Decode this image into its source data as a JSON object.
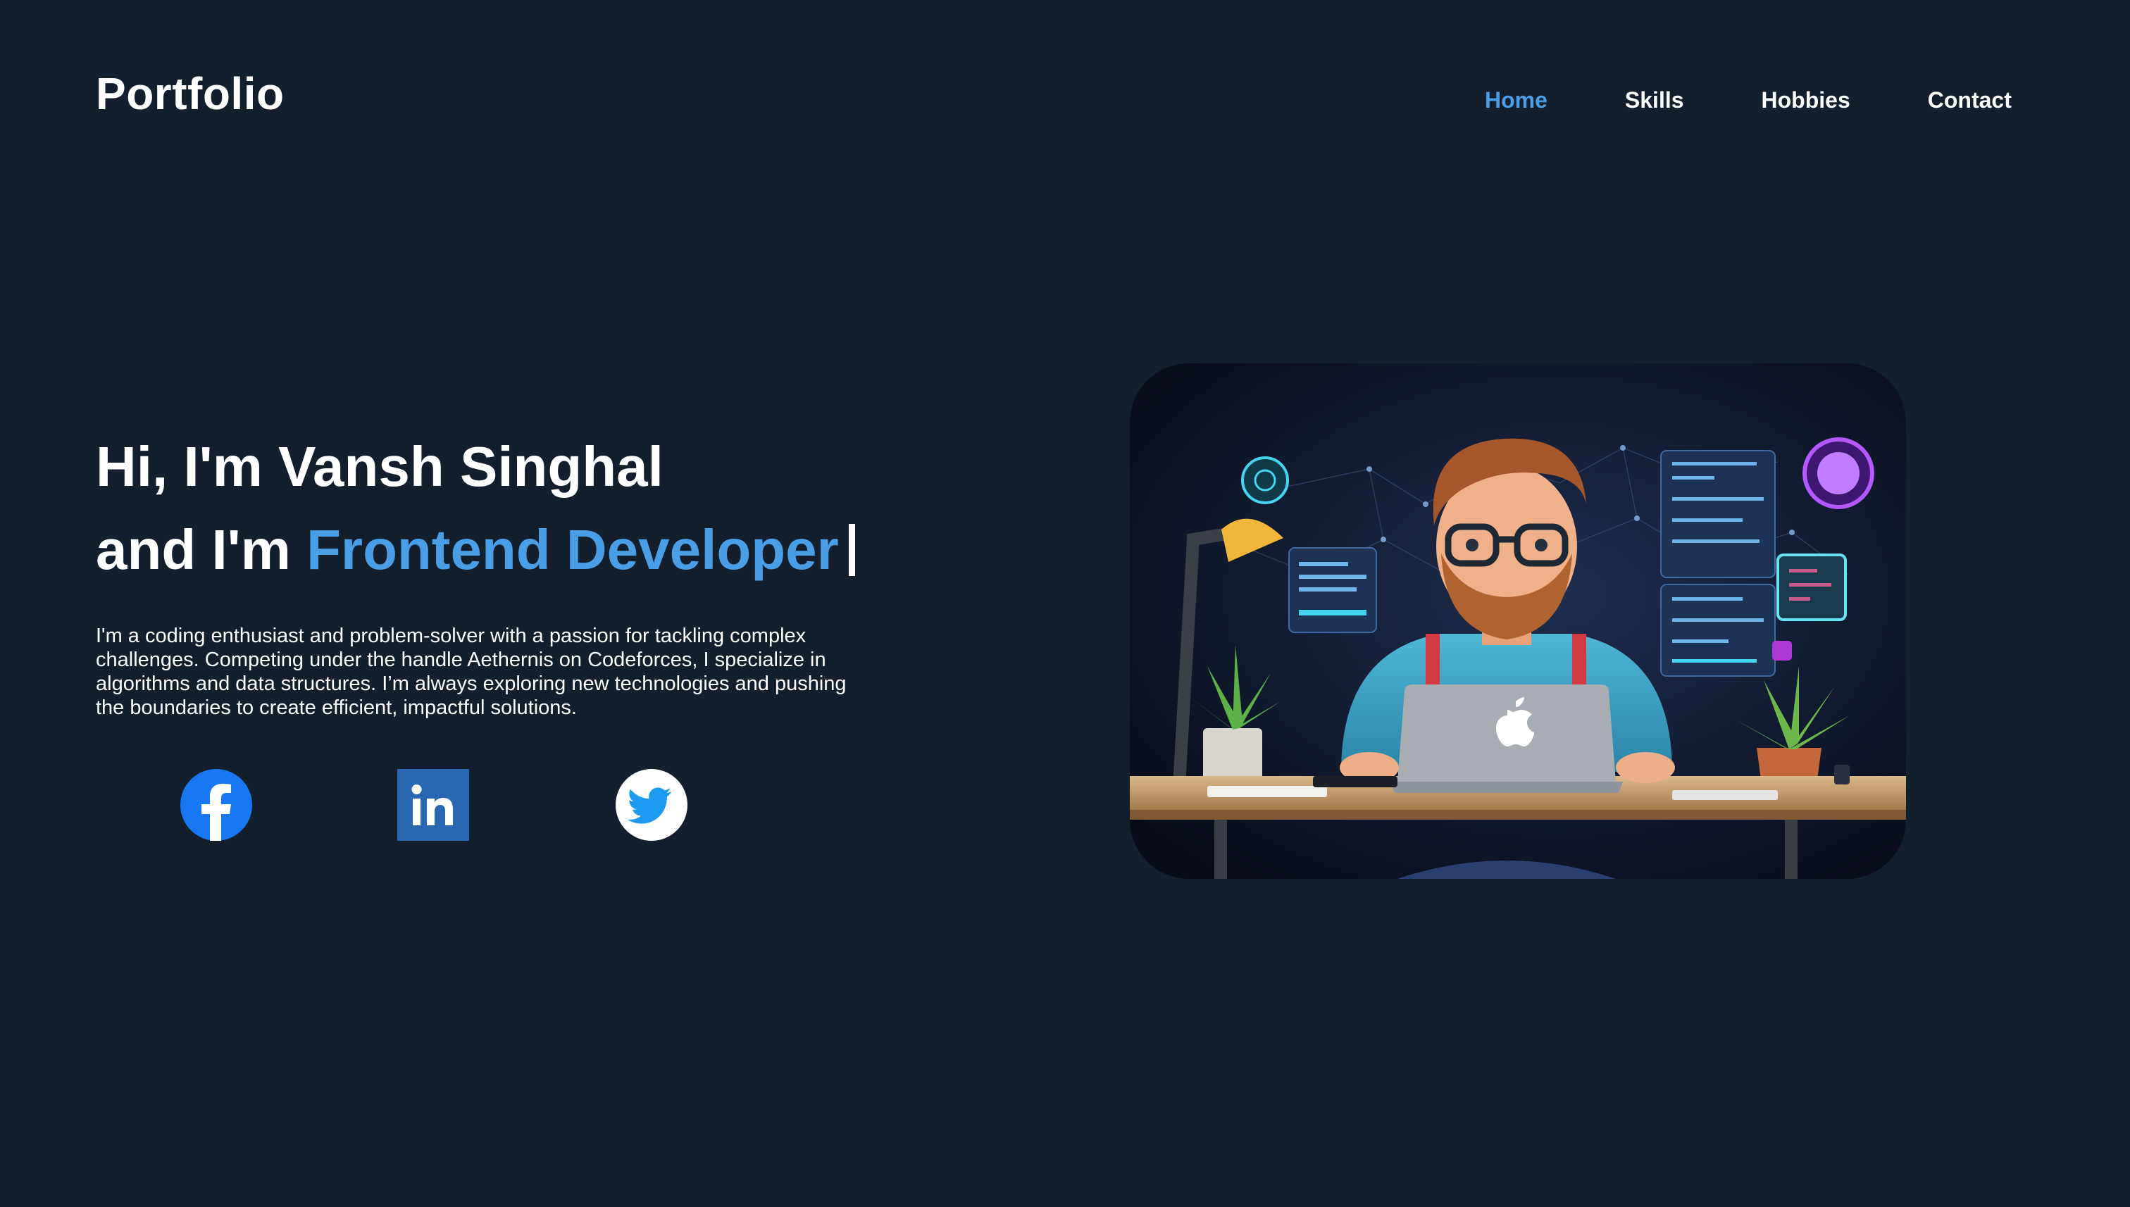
{
  "header": {
    "logo": "Portfolio",
    "nav": [
      {
        "label": "Home",
        "active": true
      },
      {
        "label": "Skills",
        "active": false
      },
      {
        "label": "Hobbies",
        "active": false
      },
      {
        "label": "Contact",
        "active": false
      }
    ]
  },
  "hero": {
    "greeting": "Hi, I'm Vansh Singhal",
    "role_prefix": "and I'm ",
    "role": "Frontend Developer",
    "bio": "I'm a coding enthusiast and problem-solver with a passion for tackling complex challenges. Competing under the handle Aethernis on Codeforces, I specialize in algorithms and data structures. I’m always exploring new technologies and pushing the boundaries to create efficient, impactful solutions."
  },
  "social": [
    {
      "icon": "facebook-icon",
      "color": "#1877f2"
    },
    {
      "icon": "linkedin-icon",
      "color": "#2867b2"
    },
    {
      "icon": "twitter-icon",
      "color": "#1d9bf0"
    }
  ],
  "colors": {
    "background": "#131f2d",
    "accent": "#4a9ee6",
    "text": "#ffffff"
  },
  "illustration": {
    "subject": "developer-at-laptop-illustration"
  }
}
